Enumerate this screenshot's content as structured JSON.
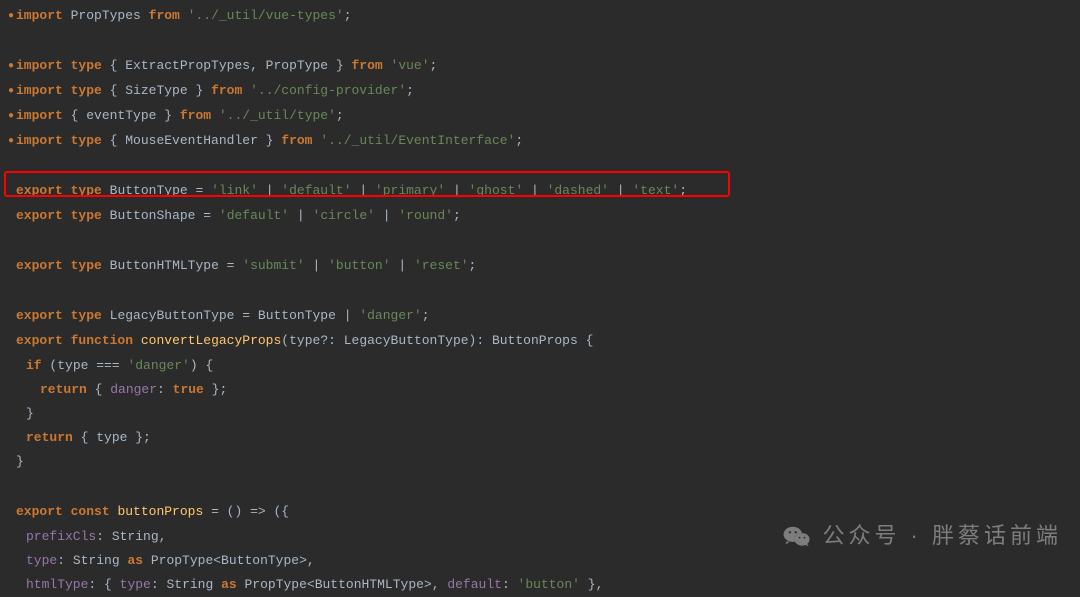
{
  "lines": [
    {
      "indent": 0,
      "bullet": true,
      "tokens": [
        [
          "kw",
          "import"
        ],
        [
          "plain",
          " PropTypes "
        ],
        [
          "kw",
          "from"
        ],
        [
          "plain",
          " "
        ],
        [
          "str",
          "'../_util/vue-types'"
        ],
        [
          "punc",
          ";"
        ]
      ]
    },
    {
      "indent": 0,
      "bullet": false,
      "tokens": [
        [
          "plain",
          " "
        ]
      ]
    },
    {
      "indent": 0,
      "bullet": true,
      "tokens": [
        [
          "kw",
          "import"
        ],
        [
          "plain",
          " "
        ],
        [
          "kw",
          "type"
        ],
        [
          "plain",
          " { ExtractPropTypes, PropType } "
        ],
        [
          "kw",
          "from"
        ],
        [
          "plain",
          " "
        ],
        [
          "str",
          "'vue'"
        ],
        [
          "punc",
          ";"
        ]
      ]
    },
    {
      "indent": 0,
      "bullet": true,
      "tokens": [
        [
          "kw",
          "import"
        ],
        [
          "plain",
          " "
        ],
        [
          "kw",
          "type"
        ],
        [
          "plain",
          " { SizeType } "
        ],
        [
          "kw",
          "from"
        ],
        [
          "plain",
          " "
        ],
        [
          "str",
          "'../config-provider'"
        ],
        [
          "punc",
          ";"
        ]
      ]
    },
    {
      "indent": 0,
      "bullet": true,
      "tokens": [
        [
          "kw",
          "import"
        ],
        [
          "plain",
          " { eventType } "
        ],
        [
          "kw",
          "from"
        ],
        [
          "plain",
          " "
        ],
        [
          "str",
          "'../_util/type'"
        ],
        [
          "punc",
          ";"
        ]
      ]
    },
    {
      "indent": 0,
      "bullet": true,
      "tokens": [
        [
          "kw",
          "import"
        ],
        [
          "plain",
          " "
        ],
        [
          "kw",
          "type"
        ],
        [
          "plain",
          " { MouseEventHandler } "
        ],
        [
          "kw",
          "from"
        ],
        [
          "plain",
          " "
        ],
        [
          "str",
          "'../_util/EventInterface'"
        ],
        [
          "punc",
          ";"
        ]
      ]
    },
    {
      "indent": 0,
      "bullet": false,
      "tokens": [
        [
          "plain",
          " "
        ]
      ]
    },
    {
      "indent": 0,
      "bullet": false,
      "tokens": [
        [
          "kw",
          "export"
        ],
        [
          "plain",
          " "
        ],
        [
          "kw",
          "type"
        ],
        [
          "plain",
          " "
        ],
        [
          "type-name",
          "ButtonType"
        ],
        [
          "plain",
          " = "
        ],
        [
          "str",
          "'link'"
        ],
        [
          "plain",
          " | "
        ],
        [
          "str",
          "'default'"
        ],
        [
          "plain",
          " | "
        ],
        [
          "str",
          "'primary'"
        ],
        [
          "plain",
          " | "
        ],
        [
          "str",
          "'ghost'"
        ],
        [
          "plain",
          " | "
        ],
        [
          "str",
          "'dashed'"
        ],
        [
          "plain",
          " | "
        ],
        [
          "str",
          "'text'"
        ],
        [
          "punc",
          ";"
        ]
      ]
    },
    {
      "indent": 0,
      "bullet": false,
      "tokens": [
        [
          "kw",
          "export"
        ],
        [
          "plain",
          " "
        ],
        [
          "kw",
          "type"
        ],
        [
          "plain",
          " "
        ],
        [
          "type-name",
          "ButtonShape"
        ],
        [
          "plain",
          " = "
        ],
        [
          "str",
          "'default'"
        ],
        [
          "plain",
          " | "
        ],
        [
          "str",
          "'circle'"
        ],
        [
          "plain",
          " | "
        ],
        [
          "str",
          "'round'"
        ],
        [
          "punc",
          ";"
        ]
      ]
    },
    {
      "indent": 0,
      "bullet": false,
      "tokens": [
        [
          "plain",
          " "
        ]
      ]
    },
    {
      "indent": 0,
      "bullet": false,
      "tokens": [
        [
          "kw",
          "export"
        ],
        [
          "plain",
          " "
        ],
        [
          "kw",
          "type"
        ],
        [
          "plain",
          " "
        ],
        [
          "type-name",
          "ButtonHTMLType"
        ],
        [
          "plain",
          " = "
        ],
        [
          "str",
          "'submit'"
        ],
        [
          "plain",
          " | "
        ],
        [
          "str",
          "'button'"
        ],
        [
          "plain",
          " | "
        ],
        [
          "str",
          "'reset'"
        ],
        [
          "punc",
          ";"
        ]
      ]
    },
    {
      "indent": 0,
      "bullet": false,
      "tokens": [
        [
          "plain",
          " "
        ]
      ]
    },
    {
      "indent": 0,
      "bullet": false,
      "tokens": [
        [
          "kw",
          "export"
        ],
        [
          "plain",
          " "
        ],
        [
          "kw",
          "type"
        ],
        [
          "plain",
          " "
        ],
        [
          "type-name",
          "LegacyButtonType"
        ],
        [
          "plain",
          " = ButtonType | "
        ],
        [
          "str",
          "'danger'"
        ],
        [
          "punc",
          ";"
        ]
      ]
    },
    {
      "indent": 0,
      "bullet": false,
      "tokens": [
        [
          "kw",
          "export"
        ],
        [
          "plain",
          " "
        ],
        [
          "kw",
          "function"
        ],
        [
          "plain",
          " "
        ],
        [
          "ident",
          "convertLegacyProps"
        ],
        [
          "plain",
          "("
        ],
        [
          "plain",
          "type?"
        ],
        [
          "plain",
          ": LegacyButtonType): ButtonProps {"
        ]
      ]
    },
    {
      "indent": 1,
      "bullet": false,
      "tokens": [
        [
          "kw",
          "if"
        ],
        [
          "plain",
          " ("
        ],
        [
          "plain",
          "type"
        ],
        [
          "plain",
          " === "
        ],
        [
          "str",
          "'danger'"
        ],
        [
          "plain",
          ") {"
        ]
      ]
    },
    {
      "indent": 2,
      "bullet": false,
      "tokens": [
        [
          "kw",
          "return"
        ],
        [
          "plain",
          " { "
        ],
        [
          "prop",
          "danger"
        ],
        [
          "plain",
          ": "
        ],
        [
          "bool",
          "true"
        ],
        [
          "plain",
          " };"
        ]
      ]
    },
    {
      "indent": 1,
      "bullet": false,
      "tokens": [
        [
          "plain",
          "}"
        ]
      ]
    },
    {
      "indent": 1,
      "bullet": false,
      "tokens": [
        [
          "kw",
          "return"
        ],
        [
          "plain",
          " { "
        ],
        [
          "plain",
          "type"
        ],
        [
          "plain",
          " };"
        ]
      ]
    },
    {
      "indent": 0,
      "bullet": false,
      "tokens": [
        [
          "plain",
          "}"
        ]
      ]
    },
    {
      "indent": 0,
      "bullet": false,
      "tokens": [
        [
          "plain",
          " "
        ]
      ]
    },
    {
      "indent": 0,
      "bullet": false,
      "tokens": [
        [
          "kw",
          "export"
        ],
        [
          "plain",
          " "
        ],
        [
          "kw",
          "const"
        ],
        [
          "plain",
          " "
        ],
        [
          "ident",
          "buttonProps"
        ],
        [
          "plain",
          " = () => ({"
        ]
      ]
    },
    {
      "indent": 1,
      "bullet": false,
      "tokens": [
        [
          "prop",
          "prefixCls"
        ],
        [
          "plain",
          ": String,"
        ]
      ]
    },
    {
      "indent": 1,
      "bullet": false,
      "tokens": [
        [
          "prop",
          "type"
        ],
        [
          "plain",
          ": String "
        ],
        [
          "kw",
          "as"
        ],
        [
          "plain",
          " PropType<ButtonType>,"
        ]
      ]
    },
    {
      "indent": 1,
      "bullet": false,
      "tokens": [
        [
          "prop",
          "htmlType"
        ],
        [
          "plain",
          ": { "
        ],
        [
          "prop",
          "type"
        ],
        [
          "plain",
          ": String "
        ],
        [
          "kw",
          "as"
        ],
        [
          "plain",
          " PropType<ButtonHTMLType>, "
        ],
        [
          "prop",
          "default"
        ],
        [
          "plain",
          ": "
        ],
        [
          "str",
          "'button'"
        ],
        [
          "plain",
          " },"
        ]
      ]
    }
  ],
  "watermark": {
    "label": "公众号 · 胖蔡话前端"
  }
}
